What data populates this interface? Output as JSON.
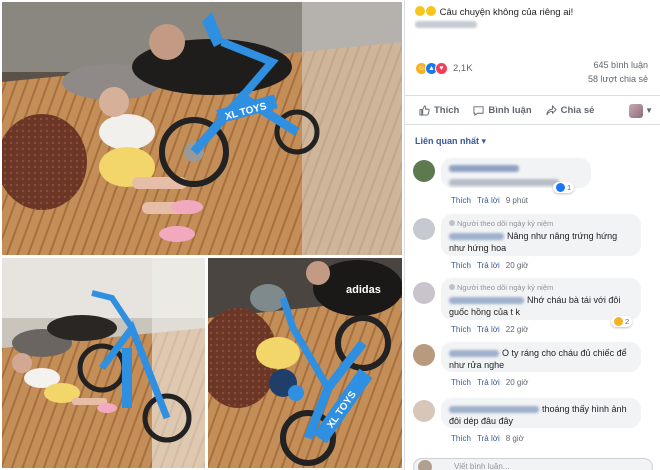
{
  "post": {
    "caption": "Câu chuyện không của riêng ai!",
    "caption_emoji": "rolling-on-floor-laughing",
    "reaction_icons": [
      "haha",
      "like",
      "love"
    ],
    "reaction_count": "2,1K",
    "comments_count": "645 bình luận",
    "shares_count": "58 lượt chia sẻ"
  },
  "actions": {
    "like": "Thích",
    "comment": "Bình luận",
    "share": "Chia sẻ"
  },
  "sort_label": "Liên quan nhất",
  "comments": [
    {
      "badge": "",
      "text": "",
      "reply": "",
      "reply_label": "",
      "time": "",
      "reaction_count": "1",
      "reaction_icon": "like"
    },
    {
      "badge": "Người theo dõi ngày kỷ niệm",
      "text": "Nâng như nâng trứng hứng như hứng hoa",
      "like_label": "Thích",
      "reply_label": "Trả lời",
      "time": "20 giờ"
    },
    {
      "badge": "Người theo dõi ngày kỷ niệm",
      "text": "Nhớ cháu bà tái với đôi guốc hồng của t k",
      "like_label": "Thích",
      "reply_label": "Trả lời",
      "time": "22 giờ",
      "reaction_count": "2",
      "reaction_icon": "haha"
    },
    {
      "badge": "",
      "text": "O ty ráng cho cháu đủ chiếc để như rửa nghe",
      "like_label": "Thích",
      "reply_label": "Trả lời",
      "time": "20 giờ"
    },
    {
      "badge": "",
      "text": "thoáng thấy hình ảnh đôi dép đâu đây",
      "like_label": "Thích",
      "reply_label": "Trả lời",
      "time": "8 giờ"
    }
  ],
  "first_comment_meta": {
    "like_label": "Thích",
    "reply_label": "Trả lời",
    "time": "9 phút"
  },
  "write_placeholder": "Viết bình luận...",
  "photo_text": {
    "bike_brand_top": "XL TOYS",
    "bike_brand_bottom": "XL TOYS",
    "shirt_brand": "adidas"
  },
  "colors": {
    "fb_blue": "#385898",
    "like_blue": "#1877f2",
    "bike_blue": "#2f8fe0",
    "mat_tan": "#c08a52"
  }
}
